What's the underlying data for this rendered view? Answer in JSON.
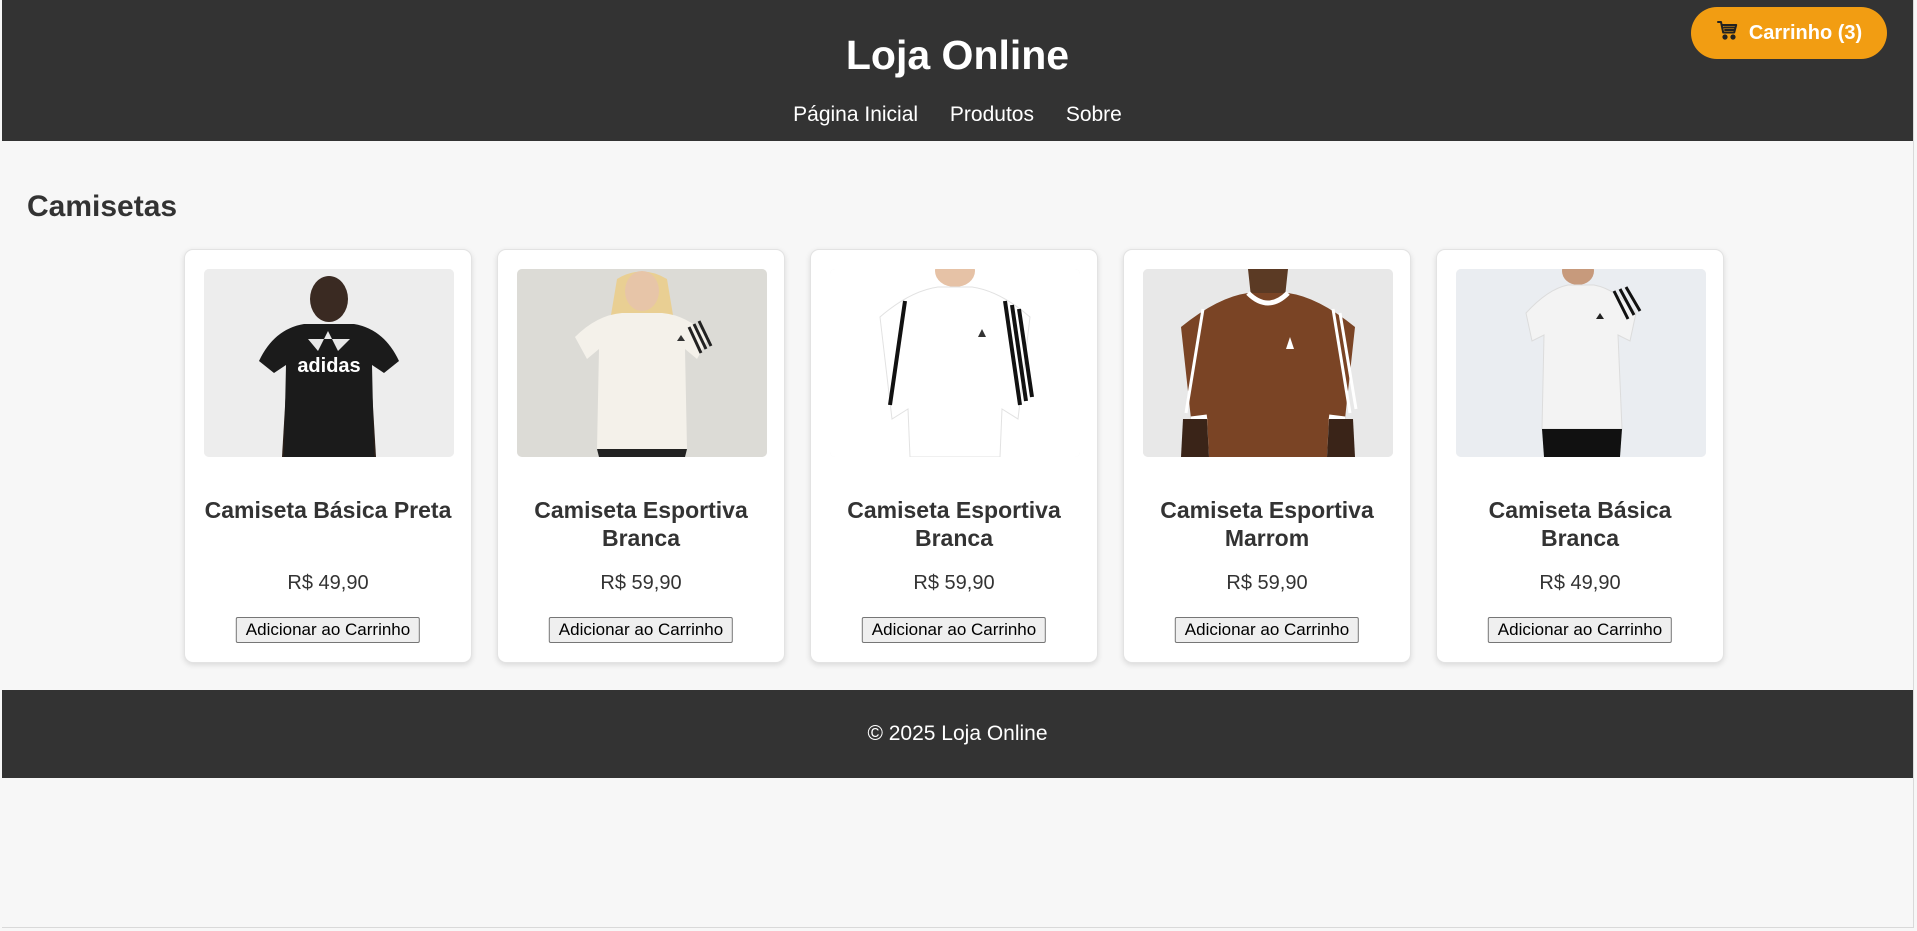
{
  "header": {
    "title": "Loja Online",
    "nav": [
      "Página Inicial",
      "Produtos",
      "Sobre"
    ],
    "cart_label": "Carrinho (3)"
  },
  "section": {
    "title": "Camisetas"
  },
  "products": [
    {
      "name": "Camiseta Básica Preta",
      "price": "R$ 49,90",
      "button": "Adicionar ao Carrinho",
      "shirt_color": "#1b1b1b",
      "image": "model-black-adidas-tshirt"
    },
    {
      "name": "Camiseta Esportiva Branca",
      "price": "R$ 59,90",
      "button": "Adicionar ao Carrinho",
      "shirt_color": "#f4f1ea",
      "image": "model-white-sport-tshirt-woman"
    },
    {
      "name": "Camiseta Esportiva Branca",
      "price": "R$ 59,90",
      "button": "Adicionar ao Carrinho",
      "shirt_color": "#ffffff",
      "image": "model-white-sport-tshirt"
    },
    {
      "name": "Camiseta Esportiva Marrom",
      "price": "R$ 59,90",
      "button": "Adicionar ao Carrinho",
      "shirt_color": "#7a4425",
      "image": "model-brown-sport-tshirt"
    },
    {
      "name": "Camiseta Básica Branca",
      "price": "R$ 49,90",
      "button": "Adicionar ao Carrinho",
      "shirt_color": "#f3f3f3",
      "image": "model-white-basic-tshirt"
    }
  ],
  "footer": {
    "text": "© 2025 Loja Online"
  },
  "colors": {
    "header_bg": "#333333",
    "accent": "#f29d12",
    "page_bg": "#f7f7f7"
  }
}
